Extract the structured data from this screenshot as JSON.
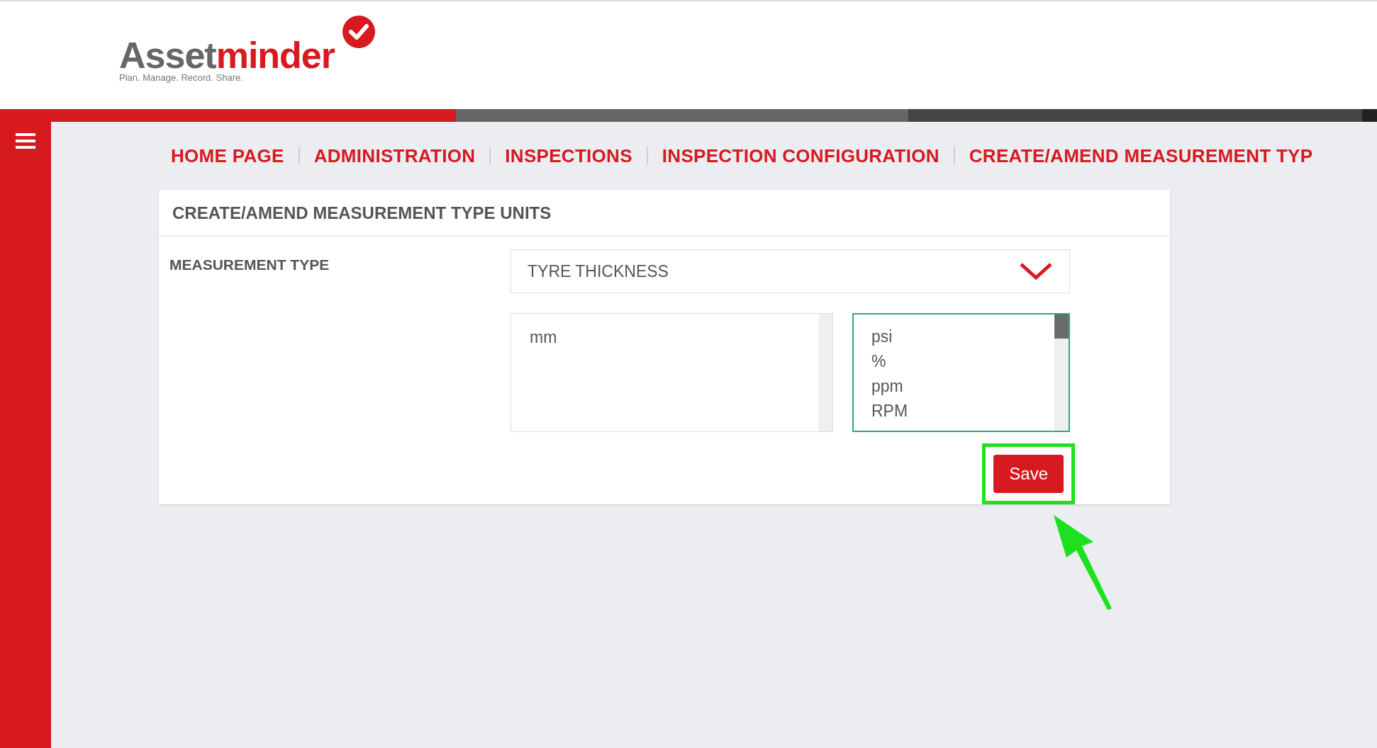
{
  "logo": {
    "name_part_1": "Asset",
    "name_part_2": "minder",
    "tagline": "Plan. Manage. Record. Share."
  },
  "breadcrumbs": [
    {
      "label": "HOME PAGE"
    },
    {
      "label": "ADMINISTRATION"
    },
    {
      "label": "INSPECTIONS"
    },
    {
      "label": "INSPECTION CONFIGURATION"
    },
    {
      "label": "CREATE/AMEND MEASUREMENT TYP"
    }
  ],
  "card": {
    "title": "CREATE/AMEND MEASUREMENT TYPE UNITS",
    "field_label": "MEASUREMENT TYPE",
    "select_value": "TYRE THICKNESS",
    "assigned_units": [
      "mm"
    ],
    "available_units": [
      "psi",
      "%",
      "ppm",
      "RPM"
    ],
    "save_button": "Save"
  }
}
